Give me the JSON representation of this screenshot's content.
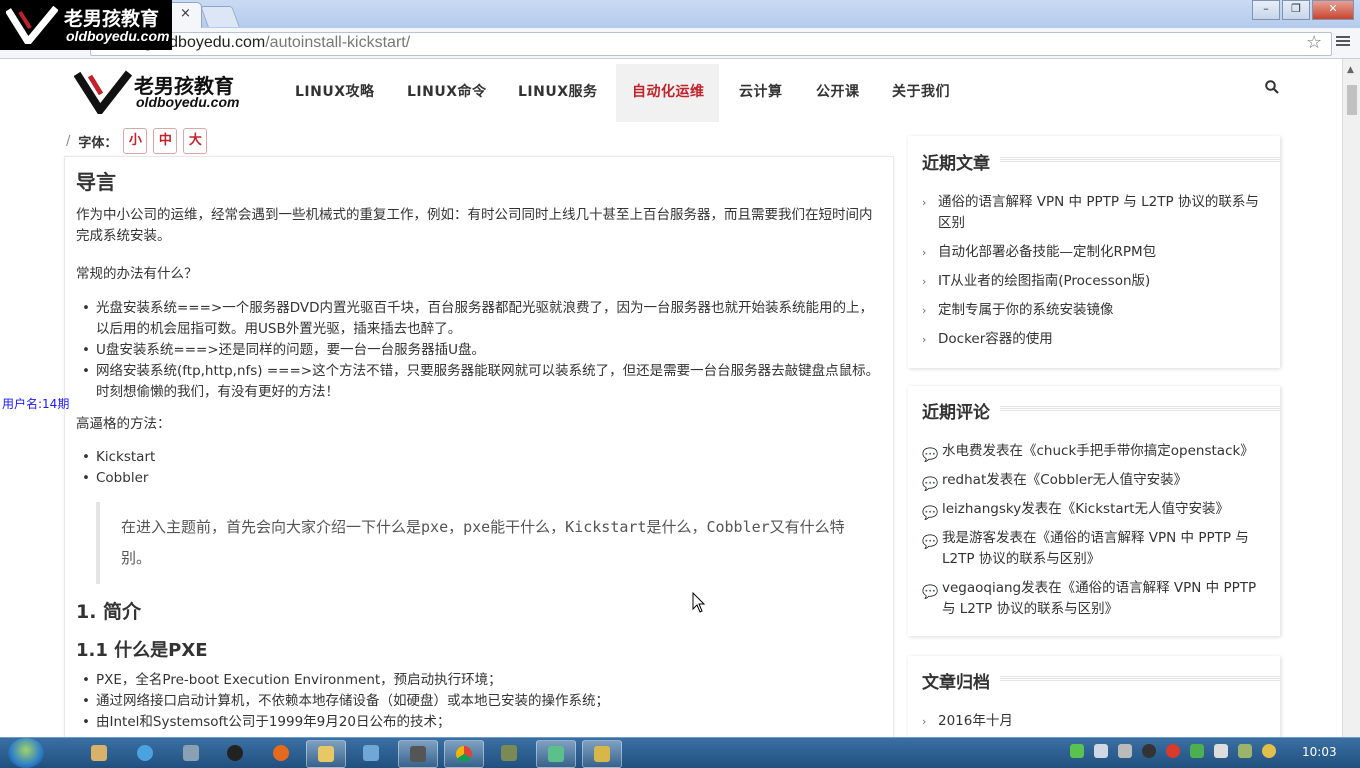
{
  "browser": {
    "url_host": "blog.oldboyedu.com",
    "url_path": "/autoinstall-kickstart/",
    "tab_close": "×"
  },
  "watermark": {
    "line1": "老男孩教育",
    "line2": "oldboyedu.com"
  },
  "site": {
    "logo_line1": "老男孩教育",
    "logo_line2": "oldboyedu.com",
    "nav": [
      "LINUX攻略",
      "LINUX命令",
      "LINUX服务",
      "自动化运维",
      "云计算",
      "公开课",
      "关于我们"
    ],
    "nav_active": "自动化运维",
    "accent_color": "#c0232a"
  },
  "font_size": {
    "sep": "/",
    "label": "字体：",
    "small": "小",
    "medium": "中",
    "large": "大"
  },
  "article": {
    "title": "导言",
    "intro": "作为中小公司的运维，经常会遇到一些机械式的重复工作，例如：有时公司同时上线几十甚至上百台服务器，而且需要我们在短时间内完成系统安装。",
    "question": "常规的办法有什么？",
    "methods": [
      "光盘安装系统===>一个服务器DVD内置光驱百千块，百台服务器都配光驱就浪费了，因为一台服务器也就开始装系统能用的上，以后用的机会屈指可数。用USB外置光驱，插来插去也醉了。",
      "U盘安装系统===>还是同样的问题，要一台一台服务器插U盘。",
      "网络安装系统(ftp,http,nfs) ===>这个方法不错，只要服务器能联网就可以装系统了，但还是需要一台台服务器去敲键盘点鼠标。时刻想偷懒的我们，有没有更好的方法！"
    ],
    "better_label": "高逼格的方法：",
    "better": [
      "Kickstart",
      "Cobbler"
    ],
    "quote": "在进入主题前，首先会向大家介绍一下什么是pxe，pxe能干什么，Kickstart是什么，Cobbler又有什么特别。",
    "h_intro": "1. 简介",
    "h_pxe": "1.1 什么是PXE",
    "pxe_points": [
      "PXE，全名Pre-boot Execution Environment，预启动执行环境；",
      "通过网络接口启动计算机，不依赖本地存储设备（如硬盘）或本地已安装的操作系统；",
      "由Intel和Systemsoft公司于1999年9月20日公布的技术；"
    ]
  },
  "sidebar": {
    "recent_title": "近期文章",
    "recent_posts": [
      "通俗的语言解释 VPN 中 PPTP 与 L2TP 协议的联系与区别",
      "自动化部署必备技能—定制化RPM包",
      "IT从业者的绘图指南(Processon版)",
      "定制专属于你的系统安装镜像",
      "Docker容器的使用"
    ],
    "comments_title": "近期评论",
    "comments": [
      "水电费发表在《chuck手把手带你搞定openstack》",
      "redhat发表在《Cobbler无人值守安装》",
      "leizhangsky发表在《Kickstart无人值守安装》",
      "我是游客发表在《通俗的语言解释 VPN 中 PPTP 与 L2TP 协议的联系与区别》",
      "vegaoqiang发表在《通俗的语言解释 VPN 中 PPTP 与 L2TP 协议的联系与区别》"
    ],
    "archive_title": "文章归档",
    "archives": [
      "2016年十月"
    ]
  },
  "overlay": {
    "username": "用户名:14期"
  },
  "taskbar": {
    "clock": "10:03"
  }
}
